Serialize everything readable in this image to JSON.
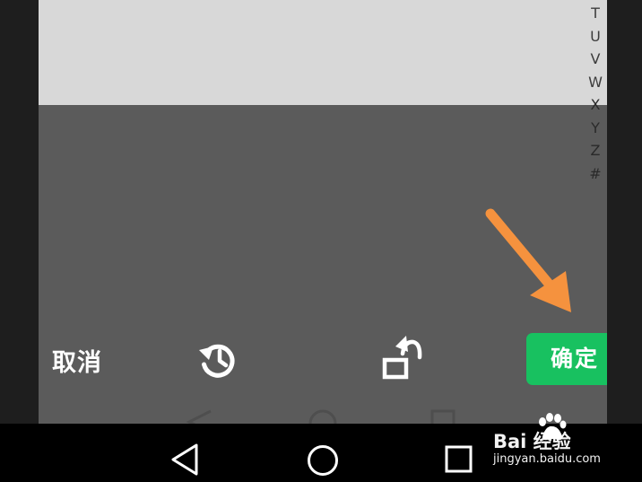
{
  "alphabet_index": [
    "T",
    "U",
    "V",
    "W",
    "X",
    "Y",
    "Z",
    "#"
  ],
  "toolbar": {
    "cancel_label": "取消",
    "confirm_label": "确定"
  },
  "icons": {
    "history": "history-icon",
    "rotate": "rotate-icon",
    "annotation_arrow": "orange-arrow-icon",
    "nav_back": "back-triangle-icon",
    "nav_home": "home-circle-icon",
    "nav_recent": "recent-square-icon"
  },
  "colors": {
    "confirm_button": "#18c160",
    "annotation_arrow": "#f5923e",
    "dim_overlay": "#5b5b5b"
  },
  "watermark": {
    "brand": "Bai 经验",
    "url": "jingyan.baidu.com"
  }
}
